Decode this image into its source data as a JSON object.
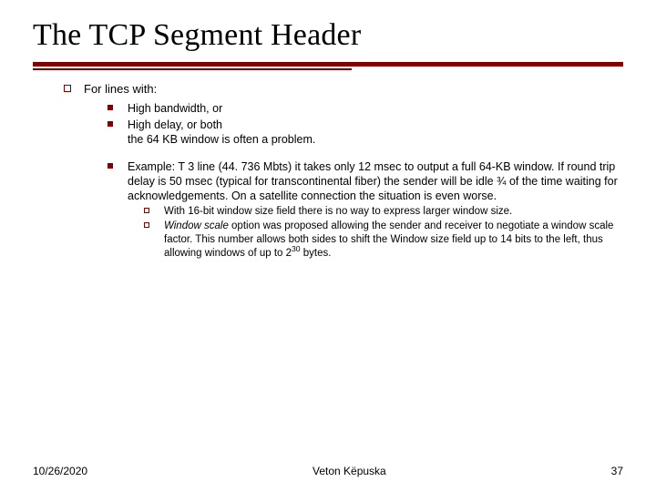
{
  "title": "The TCP Segment Header",
  "lvl1_text": "For lines with:",
  "bullets2": {
    "a": "High bandwidth, or",
    "b": "High delay, or both",
    "b2": "the 64 KB window is often a problem.",
    "c": "Example: T 3 line (44. 736 Mbts) it takes only 12 msec to output a full 64-KB window. If round trip delay is 50 msec (typical for transcontinental fiber) the sender will be idle ¾ of the time waiting for acknowledgements. On a satellite connection the situation is even worse."
  },
  "bullets3": {
    "a": "With 16-bit window size field there is no way to express larger window size.",
    "b_lead_italic": "Window scale",
    "b_rest_pre": " option was proposed allowing the sender and receiver to negotiate a window scale factor. This number allows both sides to shift the Window size field up to 14 bits to the left, thus allowing windows of up to 2",
    "b_sup": "30",
    "b_rest_post": " bytes."
  },
  "footer": {
    "date": "10/26/2020",
    "author": "Veton Këpuska",
    "page": "37"
  }
}
